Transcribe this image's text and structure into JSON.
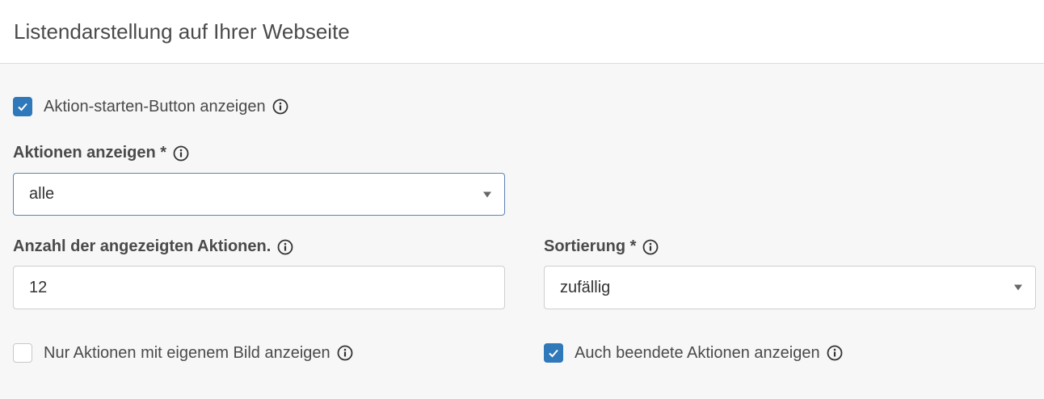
{
  "header": {
    "title": "Listendarstellung auf Ihrer Webseite"
  },
  "start_button": {
    "label": "Aktion-starten-Button anzeigen",
    "checked": true
  },
  "actions_field": {
    "label": "Aktionen anzeigen *",
    "value": "alle"
  },
  "count_field": {
    "label": "Anzahl der angezeigten Aktionen.",
    "value": "12"
  },
  "sort_field": {
    "label": "Sortierung *",
    "value": "zufällig"
  },
  "own_image": {
    "label": "Nur Aktionen mit eigenem Bild anzeigen",
    "checked": false
  },
  "ended_actions": {
    "label": "Auch beendete Aktionen anzeigen",
    "checked": true
  },
  "colors": {
    "accent": "#2f78b9",
    "text": "#4a4a4a",
    "background": "#f7f7f7"
  }
}
